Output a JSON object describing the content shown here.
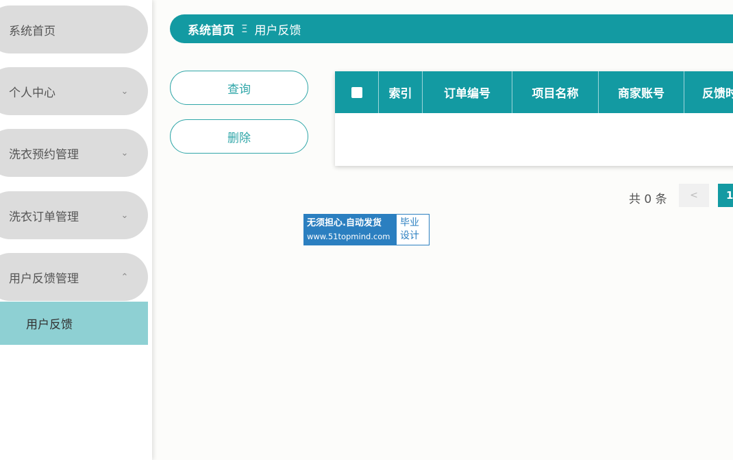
{
  "sidebar": {
    "items": [
      {
        "label": "系统首页",
        "chevron": ""
      },
      {
        "label": "个人中心",
        "chevron": "chevron-down-icon"
      },
      {
        "label": "洗衣预约管理",
        "chevron": "chevron-down-icon"
      },
      {
        "label": "洗衣订单管理",
        "chevron": "chevron-down-icon"
      },
      {
        "label": "用户反馈管理",
        "chevron": "chevron-up-icon"
      }
    ],
    "submenu_active": "用户反馈"
  },
  "breadcrumb": {
    "home": "系统首页",
    "separator": "Ξ",
    "current": "用户反馈"
  },
  "actions": {
    "query_label": "查询",
    "delete_label": "删除"
  },
  "table": {
    "columns": [
      "索引",
      "订单编号",
      "项目名称",
      "商家账号",
      "反馈时"
    ],
    "rows": []
  },
  "pagination": {
    "total_text": "共 0 条",
    "prev": "<",
    "current_page": "1"
  },
  "watermark": {
    "line1": "无须担心.自动发货",
    "line2": "www.51topmind.com",
    "right1": "毕业",
    "right2": "设计"
  },
  "colors": {
    "accent": "#139aa2",
    "sidebar_item_bg": "#dcdcdc",
    "submenu_active_bg": "#8ed0d3",
    "button_border": "#2fa6a8",
    "watermark_blue": "#2b7fc0"
  }
}
